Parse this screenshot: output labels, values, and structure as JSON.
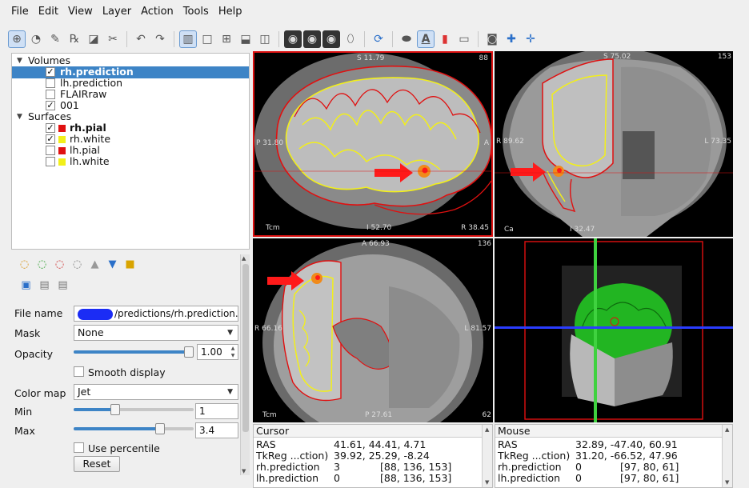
{
  "menu": [
    "File",
    "Edit",
    "View",
    "Layer",
    "Action",
    "Tools",
    "Help"
  ],
  "toolbar_icons": [
    "navigate-tool-icon",
    "measure-tool-icon",
    "voxel-edit-icon",
    "recon-edit-icon",
    "roi-edit-icon",
    "point-set-edit-icon",
    "undo-icon",
    "redo-icon",
    "layout-1x3-icon",
    "layout-1x1-icon",
    "layout-2x2-icon",
    "layout-1x3-horizontal-icon",
    "layout-3x1-icon",
    "view-sagittal-icon",
    "view-coronal-icon",
    "view-axial-icon",
    "view-3d-icon",
    "reset-view-icon",
    "show-surface-icon",
    "show-annotation-icon",
    "show-colorbar-icon",
    "show-coordinate-icon",
    "camera-icon",
    "sync-cursor-icon",
    "sync-views-icon"
  ],
  "layer_tree": {
    "volumes_label": "Volumes",
    "surfaces_label": "Surfaces",
    "volumes": [
      {
        "name": "rh.prediction",
        "checked": true,
        "selected": true,
        "bold": true
      },
      {
        "name": "lh.prediction",
        "checked": false
      },
      {
        "name": "FLAIRraw",
        "checked": false
      },
      {
        "name": "001",
        "checked": true
      }
    ],
    "surfaces": [
      {
        "name": "rh.pial",
        "checked": true,
        "color": "#e01010",
        "bold": true
      },
      {
        "name": "rh.white",
        "checked": true,
        "color": "#f2ef1a"
      },
      {
        "name": "lh.pial",
        "checked": false,
        "color": "#e01010"
      },
      {
        "name": "lh.white",
        "checked": false,
        "color": "#f2ef1a"
      }
    ]
  },
  "properties": {
    "file_name_label": "File name",
    "file_name_value": "/predictions/rh.prediction.nii",
    "mask_label": "Mask",
    "mask_value": "None",
    "opacity_label": "Opacity",
    "opacity_value": "1.00",
    "opacity_level": 1.0,
    "smooth_display_label": "Smooth display",
    "smooth_display_checked": false,
    "color_map_label": "Color map",
    "color_map_value": "Jet",
    "min_label": "Min",
    "min_value": "1",
    "max_label": "Max",
    "max_value": "3.4",
    "use_percentile_label": "Use percentile",
    "use_percentile_checked": false,
    "reset_label": "Reset"
  },
  "views": {
    "sagittal": {
      "top": "S 11.79",
      "slice": "88",
      "left": "P 31.80",
      "right": "A",
      "bottom": "I 52.70",
      "corner_right": "R 38.45",
      "corner_left": "Tcm"
    },
    "coronal": {
      "top": "S 75.02",
      "slice": "153",
      "left": "R 89.62",
      "right": "L 73.35",
      "bottom": "I 32.47",
      "corner_right": "",
      "corner_left": "Ca"
    },
    "axial": {
      "top": "A 66.93",
      "slice": "136",
      "left": "R 66.16",
      "right": "L 81.57",
      "bottom": "P 27.61",
      "corner_left": "Tcm",
      "corner_right": "62"
    }
  },
  "colors": {
    "pial": "#e01010",
    "white": "#f2ef1a",
    "arrow": "#ff1a1a",
    "selection": "#3d84c6",
    "surface_3d": "#22b522"
  },
  "cursor_panel": {
    "title": "Cursor",
    "rows": [
      {
        "label": "RAS",
        "value": "41.61, 44.41, 4.71",
        "extra": ""
      },
      {
        "label": "TkReg ...ction)",
        "value": "39.92, 25.29, -8.24",
        "extra": ""
      },
      {
        "label": "rh.prediction",
        "value": "3",
        "extra": "[88, 136, 153]"
      },
      {
        "label": "lh.prediction",
        "value": "0",
        "extra": "[88, 136, 153]"
      }
    ]
  },
  "mouse_panel": {
    "title": "Mouse",
    "rows": [
      {
        "label": "RAS",
        "value": "32.89, -47.40, 60.91",
        "extra": ""
      },
      {
        "label": "TkReg ...ction)",
        "value": "31.20, -66.52, 47.96",
        "extra": ""
      },
      {
        "label": "rh.prediction",
        "value": "0",
        "extra": "[97, 80, 61]"
      },
      {
        "label": "lh.prediction",
        "value": "0",
        "extra": "[97, 80, 61]"
      }
    ]
  }
}
